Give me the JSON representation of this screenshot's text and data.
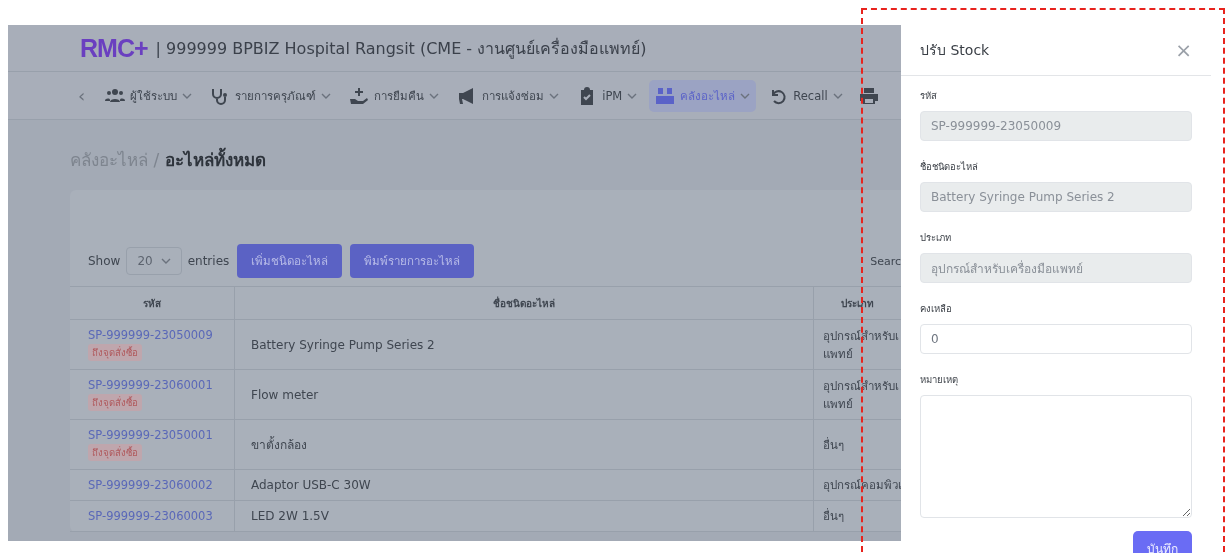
{
  "header": {
    "logo": "RMC+",
    "title": "| 999999 BPBIZ Hospital Rangsit (CME - งานศูนย์เครื่องมือแพทย์)"
  },
  "nav": {
    "back": "‹",
    "items": [
      {
        "label": "ผู้ใช้ระบบ",
        "selected": false
      },
      {
        "label": "รายการครุภัณฑ์",
        "selected": false
      },
      {
        "label": "การยืมคืน",
        "selected": false
      },
      {
        "label": "การแจ้งซ่อม",
        "selected": false
      },
      {
        "label": "iPM",
        "selected": false
      },
      {
        "label": "คลังอะไหล่",
        "selected": true
      },
      {
        "label": "Recall",
        "selected": false
      }
    ]
  },
  "breadcrumb": {
    "parent": "คลังอะไหล่ /",
    "current": "อะไหล่ทั้งหมด"
  },
  "controls": {
    "show": "Show",
    "page_size": "20",
    "entries": "entries",
    "buttons": [
      "เพิ่มชนิดอะไหล่",
      "พิมพ์รายการอะไหล่"
    ],
    "search": "Searc"
  },
  "table": {
    "columns": [
      "รหัส",
      "ชื่อชนิดอะไหล่",
      "ประเภท"
    ],
    "rows": [
      {
        "code": "SP-999999-23050009",
        "badge": "ถึงจุดสั่งซื้อ",
        "name": "Battery Syringe Pump Series 2",
        "type": [
          "อุปกรณ์สำหรับเ",
          "แพทย์"
        ]
      },
      {
        "code": "SP-999999-23060001",
        "badge": "ถึงจุดสั่งซื้อ",
        "name": "Flow meter",
        "type": [
          "อุปกรณ์สำหรับเ",
          "แพทย์"
        ]
      },
      {
        "code": "SP-999999-23050001",
        "badge": "ถึงจุดสั่งซื้อ",
        "name": "ขาตั้งกล้อง",
        "type": [
          "อื่นๆ"
        ]
      },
      {
        "code": "SP-999999-23060002",
        "name": "Adaptor USB-C 30W",
        "type": [
          "อุปกรณ์คอมพิวเ"
        ]
      },
      {
        "code": "SP-999999-23060003",
        "name": "LED 2W 1.5V",
        "type": [
          "อื่นๆ"
        ]
      }
    ]
  },
  "drawer": {
    "title": "ปรับ Stock",
    "close": "×",
    "fields": [
      {
        "kind": "input",
        "label": "รหัส",
        "value": "SP-999999-23050009",
        "disabled": true
      },
      {
        "kind": "input",
        "label": "ชื่อชนิดอะไหล่",
        "value": "Battery Syringe Pump Series 2",
        "disabled": true
      },
      {
        "kind": "input",
        "label": "ประเภท",
        "value": "อุปกรณ์สำหรับเครื่องมือแพทย์",
        "disabled": true
      },
      {
        "kind": "input",
        "label": "คงเหลือ",
        "value": "0",
        "disabled": false
      },
      {
        "kind": "textarea",
        "label": "หมายเหตุ",
        "disabled": false
      }
    ],
    "save": "บันทึก"
  }
}
